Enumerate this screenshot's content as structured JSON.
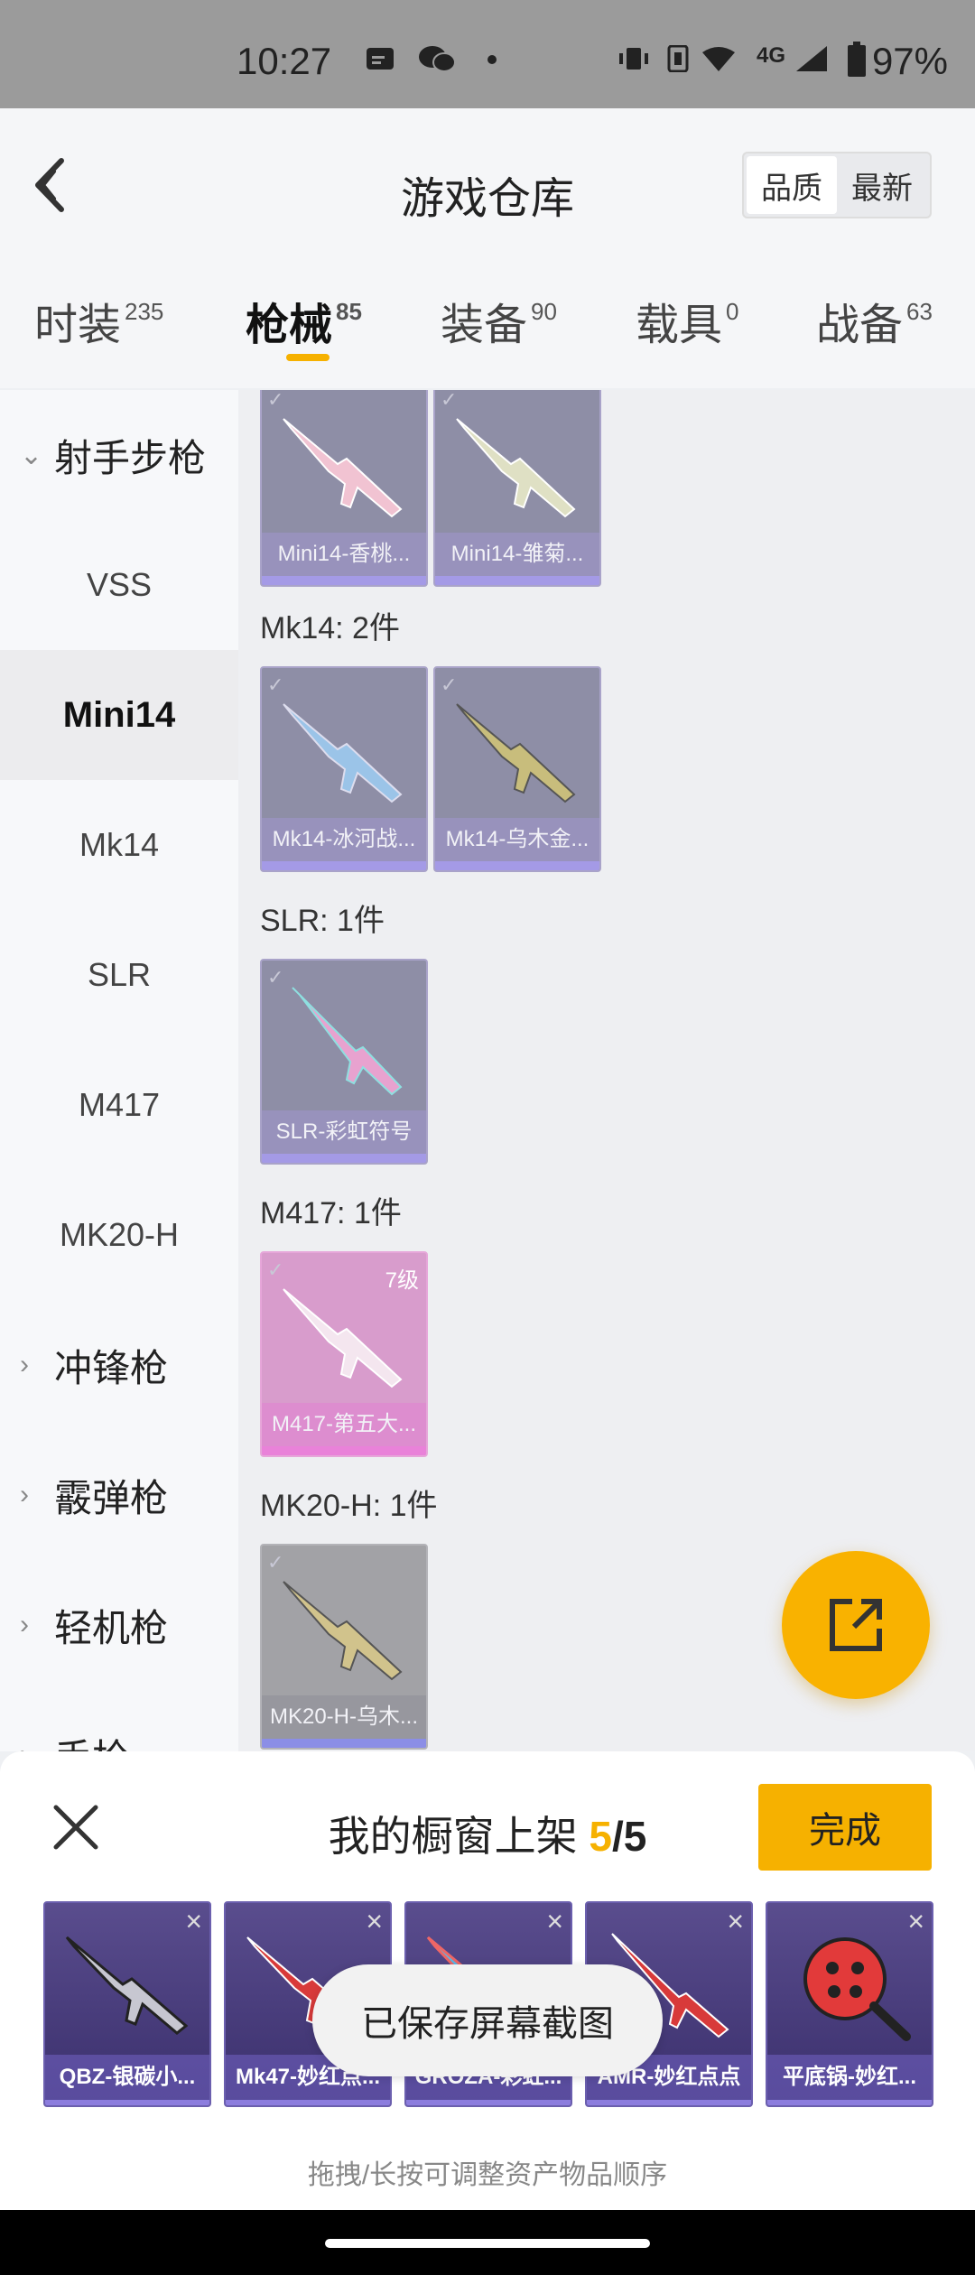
{
  "status_bar": {
    "time": "10:27",
    "network": "4G",
    "battery": "97%"
  },
  "header": {
    "title": "游戏仓库",
    "sort": [
      "品质",
      "最新"
    ]
  },
  "tabs": [
    {
      "label": "时装",
      "count": "235"
    },
    {
      "label": "枪械",
      "count": "85"
    },
    {
      "label": "装备",
      "count": "90"
    },
    {
      "label": "载具",
      "count": "0"
    },
    {
      "label": "战备",
      "count": "63"
    }
  ],
  "sidebar": {
    "items": [
      {
        "label": "射手步枪"
      },
      {
        "label": "VSS"
      },
      {
        "label": "Mini14"
      },
      {
        "label": "Mk14"
      },
      {
        "label": "SLR"
      },
      {
        "label": "M417"
      },
      {
        "label": "MK20-H"
      },
      {
        "label": "冲锋枪"
      },
      {
        "label": "霰弹枪"
      },
      {
        "label": "轻机枪"
      },
      {
        "label": "手枪"
      }
    ]
  },
  "content": {
    "sections": [
      {
        "title": "",
        "items": [
          "Mini14-香桃...",
          "Mini14-雏菊..."
        ]
      },
      {
        "title": "Mk14: 2件",
        "items": [
          "Mk14-冰河战...",
          "Mk14-乌木金..."
        ]
      },
      {
        "title": "SLR: 1件",
        "items": [
          "SLR-彩虹符号"
        ]
      },
      {
        "title": "M417: 1件",
        "items": [
          "M417-第五大..."
        ],
        "level": "7级"
      },
      {
        "title": "MK20-H: 1件",
        "items": [
          "MK20-H-乌木..."
        ]
      }
    ]
  },
  "sheet": {
    "title": "我的橱窗上架",
    "count": "5",
    "total": "/5",
    "done_label": "完成",
    "slots": [
      "QBZ-银碳小...",
      "Mk47-妙红点...",
      "GROZA-彩虹...",
      "AMR-妙红点点",
      "平底锅-妙红..."
    ],
    "hint": "拖拽/长按可调整资产物品顺序"
  },
  "toast": "已保存屏幕截图",
  "colors": {
    "accent": "#f6b100",
    "card_purple": "#8e8ea6",
    "card_pink": "#d89ccc"
  }
}
